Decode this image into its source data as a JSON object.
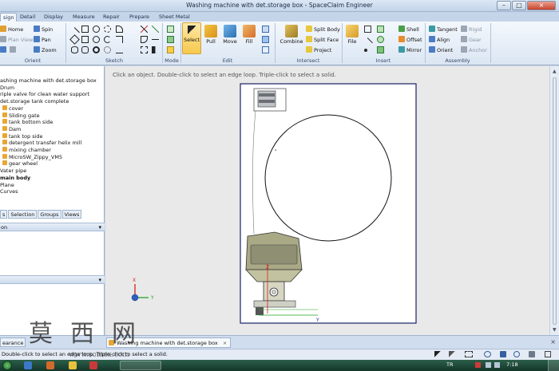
{
  "app_title": "Washing machine with det.storage box - SpaceClaim Engineer",
  "window_controls": {
    "min": "–",
    "max": "□",
    "close": "×"
  },
  "tabs": [
    "sign",
    "Detail",
    "Display",
    "Measure",
    "Repair",
    "Prepare",
    "Sheet Metal"
  ],
  "active_tab": "sign",
  "ribbon": {
    "orient": {
      "label": "Orient",
      "items": [
        "Home",
        "Spin",
        "Plan View",
        "Pan",
        "Zoom"
      ]
    },
    "sketch": {
      "label": "Sketch"
    },
    "mode": {
      "label": "Mode"
    },
    "edit": {
      "label": "Edit",
      "items": [
        "Select",
        "Pull",
        "Move",
        "Fill"
      ]
    },
    "intersect": {
      "label": "Intersect",
      "items": [
        "Combine",
        "Split Body",
        "Split Face",
        "Project"
      ]
    },
    "insert": {
      "label": "Insert",
      "items": [
        "File",
        "Shell",
        "Offset",
        "Mirror"
      ]
    },
    "assembly": {
      "label": "Assembly",
      "items": [
        "Tangent",
        "Rigid",
        "Align",
        "Gear",
        "Orient",
        "Anchor"
      ]
    }
  },
  "structure_tree": [
    {
      "label": "ashing machine with det.storage box",
      "bold": false,
      "icon": false
    },
    {
      "label": "Drum",
      "bold": false,
      "icon": false
    },
    {
      "label": "riple valve for clean water support",
      "bold": false,
      "icon": false
    },
    {
      "label": "det.storage tank complete",
      "bold": false,
      "icon": false
    },
    {
      "label": "cover",
      "bold": false,
      "icon": true
    },
    {
      "label": "Sliding gate",
      "bold": false,
      "icon": true
    },
    {
      "label": "tank bottom side",
      "bold": false,
      "icon": true
    },
    {
      "label": "Dam",
      "bold": false,
      "icon": true
    },
    {
      "label": "tank top side",
      "bold": false,
      "icon": true
    },
    {
      "label": "detergent transfer helix mill",
      "bold": false,
      "icon": true
    },
    {
      "label": "mixing chamber",
      "bold": false,
      "icon": true
    },
    {
      "label": "MicroSW_Zippy_VM5",
      "bold": false,
      "icon": true
    },
    {
      "label": "gear wheel",
      "bold": false,
      "icon": true
    },
    {
      "label": "Vater pipe",
      "bold": false,
      "icon": false
    },
    {
      "label": "main body",
      "bold": true,
      "icon": false
    },
    {
      "label": "Plane",
      "bold": false,
      "icon": false
    },
    {
      "label": "Curves",
      "bold": false,
      "icon": false
    }
  ],
  "panel_tabs": [
    "s",
    "Selection",
    "Groups",
    "Views"
  ],
  "options_header": "on",
  "properties_header": "",
  "pin": "▾",
  "viewport_hint": "Click an object. Double-click to select an edge loop. Triple-click to select a solid.",
  "axis_labels": {
    "x": "X",
    "y": "Y",
    "z": "Z"
  },
  "doc_tabs": {
    "left": "earance",
    "active": "Washing machine with det.storage box"
  },
  "status_text": "Double-click to select an edge loop. Triple-click to select a solid.",
  "taskbar": {
    "lang": "TR",
    "time": "7:18"
  },
  "watermark": {
    "chars": [
      "莫",
      "西",
      "网"
    ],
    "url": "www.somox.com"
  }
}
